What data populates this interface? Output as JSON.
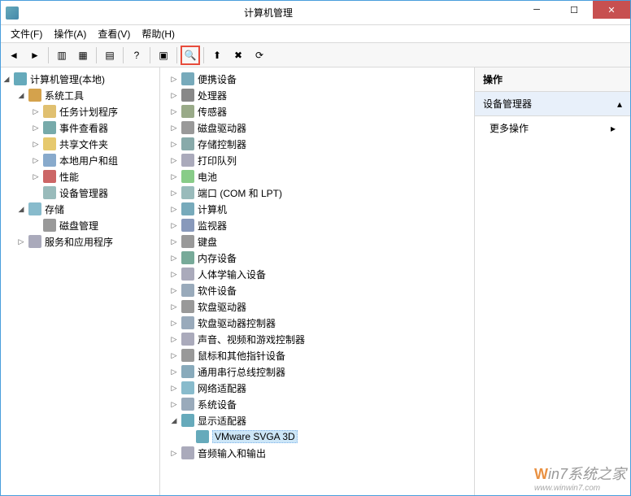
{
  "window": {
    "title": "计算机管理"
  },
  "menu": {
    "file": "文件(F)",
    "action": "操作(A)",
    "view": "查看(V)",
    "help": "帮助(H)"
  },
  "left_tree": {
    "root": "计算机管理(本地)",
    "system_tools": "系统工具",
    "task_scheduler": "任务计划程序",
    "event_viewer": "事件查看器",
    "shared_folders": "共享文件夹",
    "local_users": "本地用户和组",
    "performance": "性能",
    "device_manager": "设备管理器",
    "storage": "存储",
    "disk_mgmt": "磁盘管理",
    "services_apps": "服务和应用程序"
  },
  "device_tree": {
    "portable": "便携设备",
    "processors": "处理器",
    "sensors": "传感器",
    "disk_drives": "磁盘驱动器",
    "storage_ctrl": "存储控制器",
    "print_queues": "打印队列",
    "batteries": "电池",
    "ports": "端口 (COM 和 LPT)",
    "computer": "计算机",
    "monitors": "监视器",
    "keyboards": "键盘",
    "memory": "内存设备",
    "hid": "人体学输入设备",
    "software_dev": "软件设备",
    "floppy_drives": "软盘驱动器",
    "floppy_ctrl": "软盘驱动器控制器",
    "sound": "声音、视频和游戏控制器",
    "mice": "鼠标和其他指针设备",
    "usb": "通用串行总线控制器",
    "network": "网络适配器",
    "system_dev": "系统设备",
    "display_adapters": "显示适配器",
    "vmware_svga": "VMware SVGA 3D",
    "audio_io": "音频输入和输出"
  },
  "actions": {
    "header": "操作",
    "section": "设备管理器",
    "more": "更多操作"
  },
  "watermark": {
    "brand": "Win7系统之家",
    "url": "www.winwin7.com"
  }
}
